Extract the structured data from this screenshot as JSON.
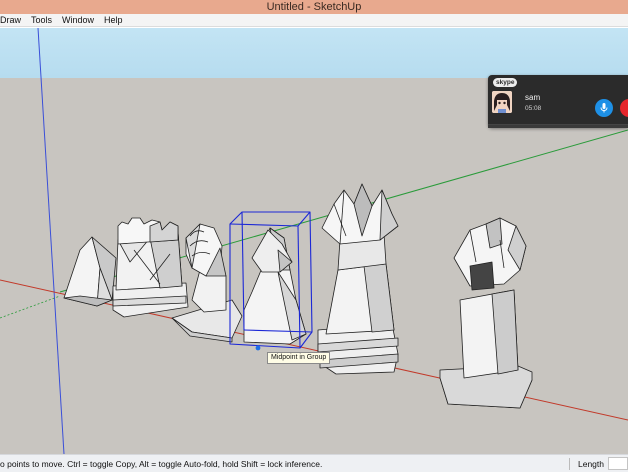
{
  "window": {
    "title": "Untitled - SketchUp"
  },
  "menu": {
    "items": [
      "Draw",
      "Tools",
      "Window",
      "Help"
    ]
  },
  "viewport": {
    "sky_color": "#bfe2f2",
    "ground_color": "#c9c6c1",
    "axis_colors": {
      "blue": "#3a4fd8",
      "green": "#2a9b3a",
      "red": "#c23a2a"
    },
    "selection_color": "#1c28d6",
    "tooltip": "Midpoint in Group"
  },
  "skype": {
    "logo": "skype",
    "contact_name": "sam",
    "call_time": "05:08",
    "mic_icon": "microphone-icon",
    "hangup_icon": "hang-up-icon"
  },
  "status": {
    "hint": "o points to move.  Ctrl = toggle Copy, Alt = toggle Auto-fold, hold Shift = lock inference.",
    "length_label": "Length",
    "length_value": ""
  }
}
